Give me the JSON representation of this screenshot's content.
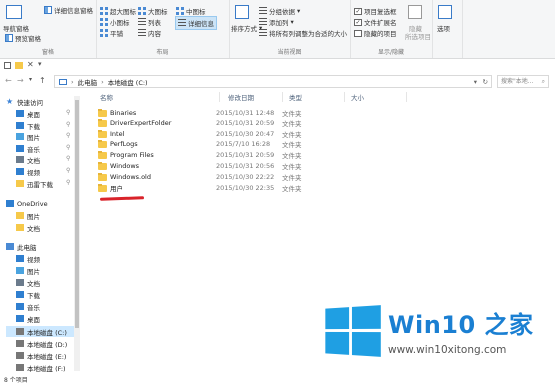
{
  "ribbon": {
    "groups": [
      {
        "title": "窗格",
        "items": [
          "导航窗格",
          "预览窗格",
          "详细信息窗格"
        ]
      },
      {
        "title": "布局",
        "items": [
          "超大图标",
          "大图标",
          "中图标",
          "小图标",
          "列表",
          "详细信息",
          "平铺",
          "内容"
        ]
      },
      {
        "title": "当前视图",
        "items": [
          "排序方式",
          "分组依据",
          "添加列",
          "将所有列调整为合适的大小"
        ]
      },
      {
        "title": "显示/隐藏",
        "items": [
          "项目复选框",
          "文件扩展名",
          "隐藏的项目",
          "隐藏",
          "所选项目"
        ]
      },
      {
        "title": "",
        "items": [
          "选项"
        ]
      }
    ]
  },
  "address": {
    "path": [
      "此电脑",
      "本地磁盘 (C:)"
    ],
    "search_placeholder": "搜索\"本地..."
  },
  "columns": {
    "name": "名称",
    "date": "修改日期",
    "type": "类型",
    "size": "大小"
  },
  "files": [
    {
      "name": "Binaries",
      "date": "2015/10/31 12:48",
      "type": "文件夹"
    },
    {
      "name": "DriverExpertFolder",
      "date": "2015/10/31 20:59",
      "type": "文件夹"
    },
    {
      "name": "Intel",
      "date": "2015/10/30 20:47",
      "type": "文件夹"
    },
    {
      "name": "PerfLogs",
      "date": "2015/7/10 16:28",
      "type": "文件夹"
    },
    {
      "name": "Program Files",
      "date": "2015/10/31 20:59",
      "type": "文件夹"
    },
    {
      "name": "Windows",
      "date": "2015/10/31 20:56",
      "type": "文件夹"
    },
    {
      "name": "Windows.old",
      "date": "2015/10/30 22:22",
      "type": "文件夹"
    },
    {
      "name": "用户",
      "date": "2015/10/30 22:35",
      "type": "文件夹"
    }
  ],
  "nav": [
    {
      "label": "快速访问",
      "kind": "star",
      "indent": 0
    },
    {
      "label": "桌面",
      "kind": "desk",
      "indent": 1,
      "pin": true
    },
    {
      "label": "下载",
      "kind": "down",
      "indent": 1,
      "pin": true
    },
    {
      "label": "图片",
      "kind": "pic",
      "indent": 1,
      "pin": true
    },
    {
      "label": "音乐",
      "kind": "music",
      "indent": 1,
      "pin": true
    },
    {
      "label": "文档",
      "kind": "doc",
      "indent": 1,
      "pin": true
    },
    {
      "label": "视频",
      "kind": "video",
      "indent": 1,
      "pin": true
    },
    {
      "label": "迅雷下载",
      "kind": "folder",
      "indent": 1,
      "pin": true
    },
    {
      "label": "OneDrive",
      "kind": "cloud",
      "indent": 0
    },
    {
      "label": "图片",
      "kind": "folder",
      "indent": 1
    },
    {
      "label": "文档",
      "kind": "folder",
      "indent": 1
    },
    {
      "label": "此电脑",
      "kind": "pc",
      "indent": 0
    },
    {
      "label": "视频",
      "kind": "video",
      "indent": 1
    },
    {
      "label": "图片",
      "kind": "pic",
      "indent": 1
    },
    {
      "label": "文档",
      "kind": "doc",
      "indent": 1
    },
    {
      "label": "下载",
      "kind": "down",
      "indent": 1
    },
    {
      "label": "音乐",
      "kind": "music",
      "indent": 1
    },
    {
      "label": "桌面",
      "kind": "desk",
      "indent": 1
    },
    {
      "label": "本地磁盘 (C:)",
      "kind": "disk",
      "indent": 1,
      "selected": true
    },
    {
      "label": "本地磁盘 (D:)",
      "kind": "disk",
      "indent": 1
    },
    {
      "label": "本地磁盘 (E:)",
      "kind": "disk",
      "indent": 1
    },
    {
      "label": "本地磁盘 (F:)",
      "kind": "disk",
      "indent": 1
    }
  ],
  "status": "8 个项目",
  "watermark": {
    "title": "Win10 之家",
    "url": "www.win10xitong.com"
  },
  "colors": {
    "folder": "#f6c94a",
    "accent": "#1f9fe3",
    "selected": "#cce8ff",
    "underline": "#d9232a"
  }
}
